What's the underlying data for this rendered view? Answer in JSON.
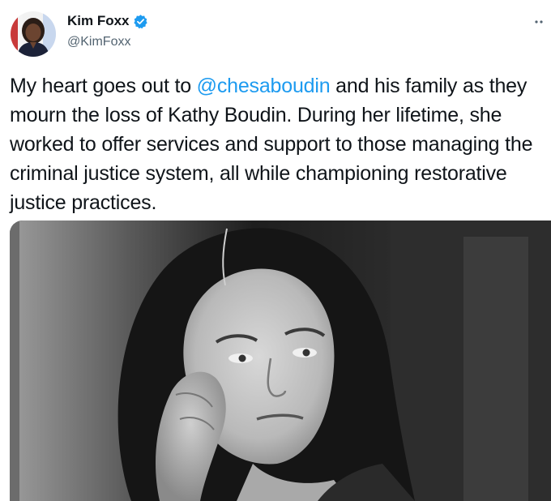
{
  "author": {
    "display_name": "Kim Foxx",
    "handle": "@KimFoxx",
    "verified": true
  },
  "tweet": {
    "text_before_mention": "My heart goes out to ",
    "mention": "@chesaboudin",
    "text_after_mention": " and his family as they mourn the loss of Kathy Boudin. During her lifetime, she worked to offer services and support to those managing the criminal justice system, all while championing restorative justice practices."
  },
  "media": {
    "kind": "black-and-white photo"
  },
  "colors": {
    "link": "#1d9bf0",
    "verified_badge": "#1d9bf0",
    "secondary_text": "#536471",
    "primary_text": "#0f1419"
  },
  "icons": {
    "verified": "verified-badge-icon",
    "more": "more-options-icon"
  }
}
